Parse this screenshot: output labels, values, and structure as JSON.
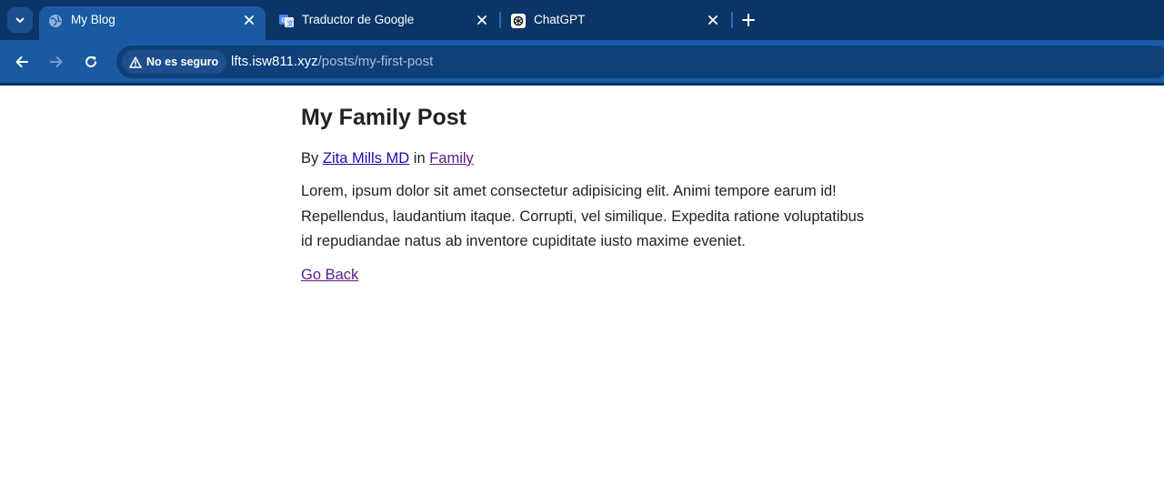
{
  "browser": {
    "tabs": [
      {
        "title": "My Blog",
        "active": true,
        "icon": "globe-icon"
      },
      {
        "title": "Traductor de Google",
        "active": false,
        "icon": "google-translate-icon"
      },
      {
        "title": "ChatGPT",
        "active": false,
        "icon": "chatgpt-icon"
      }
    ],
    "security_label": "No es seguro",
    "url_host": "lfts.isw811.xyz",
    "url_path": "/posts/my-first-post",
    "colors": {
      "tabstrip": "#0b3566",
      "toolbar": "#1a5aa3",
      "omnibox": "#0e3f78"
    }
  },
  "post": {
    "title": "My Family Post",
    "by_label": "By",
    "author": "Zita Mills MD",
    "in_label": "in",
    "category": "Family",
    "body": "Lorem, ipsum dolor sit amet consectetur adipisicing elit. Animi tempore earum id! Repellendus, laudantium itaque. Corrupti, vel similique. Expedita ratione voluptatibus id repudiandae natus ab inventore cupiditate iusto maxime eveniet.",
    "back_link": "Go Back"
  }
}
